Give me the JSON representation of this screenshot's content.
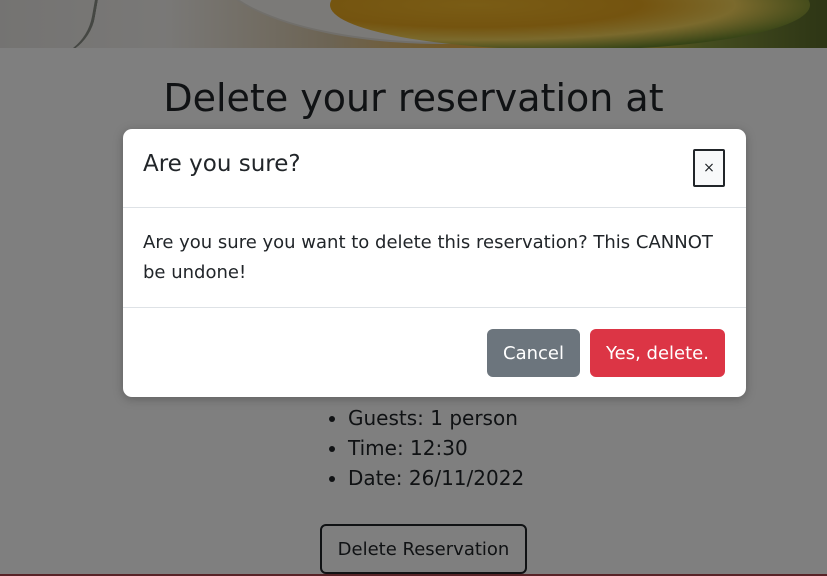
{
  "page": {
    "title": "Delete your reservation at",
    "details": [
      "Guests: 1 person",
      "Time: 12:30",
      "Date: 26/11/2022"
    ],
    "delete_button": "Delete Reservation"
  },
  "modal": {
    "title": "Are you sure?",
    "close_label": "×",
    "body": "Are you sure you want to delete this reservation? This CANNOT be undone!",
    "cancel_label": "Cancel",
    "confirm_label": "Yes, delete."
  },
  "colors": {
    "danger": "#dc3545",
    "secondary": "#6c757d",
    "backdrop": "rgba(0,0,0,0.5)"
  }
}
